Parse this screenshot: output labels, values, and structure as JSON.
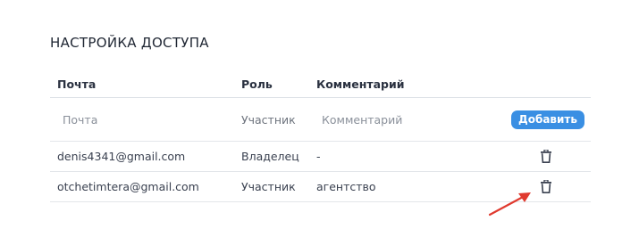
{
  "section_title": "НАСТРОЙКА ДОСТУПА",
  "table": {
    "headers": {
      "email": "Почта",
      "role": "Роль",
      "comment": "Комментарий"
    },
    "new_entry": {
      "email_placeholder": "Почта",
      "role_value": "Участник",
      "comment_placeholder": "Комментарий",
      "add_label": "Добавить"
    },
    "rows": [
      {
        "email": "denis4341@gmail.com",
        "role": "Владелец",
        "comment": "-",
        "action_icon": "trash-icon"
      },
      {
        "email": "otchetimtera@gmail.com",
        "role": "Участник",
        "comment": "агентство",
        "action_icon": "trash-icon"
      }
    ]
  },
  "colors": {
    "accent": "#3a8fe3",
    "annotation_arrow": "#e03a2f"
  }
}
